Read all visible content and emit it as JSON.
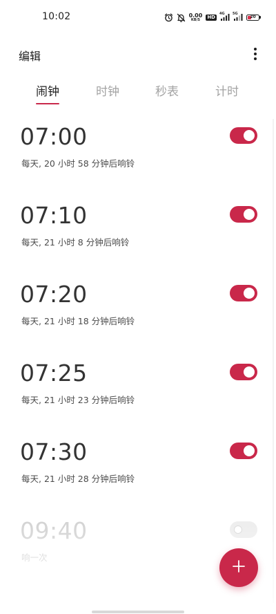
{
  "status_bar": {
    "time": "10:02",
    "net_speed_value": "0.00",
    "net_speed_unit": "KB/S",
    "hd_label": "HD",
    "signal1_tag": "4G",
    "signal2_tag": "5G",
    "battery_level": "20",
    "icons": [
      "alarm-icon",
      "mute-icon",
      "hd-icon",
      "signal-icon",
      "signal-icon",
      "battery-icon"
    ]
  },
  "header": {
    "edit_label": "编辑",
    "more_icon": "more-vertical-icon"
  },
  "tabs": [
    {
      "label": "闹钟",
      "active": true
    },
    {
      "label": "时钟",
      "active": false
    },
    {
      "label": "秒表",
      "active": false
    },
    {
      "label": "计时",
      "active": false
    }
  ],
  "alarms": [
    {
      "time": "07:00",
      "subtitle": "每天, 20 小时 58 分钟后响铃",
      "enabled": true
    },
    {
      "time": "07:10",
      "subtitle": "每天, 21 小时 8 分钟后响铃",
      "enabled": true
    },
    {
      "time": "07:20",
      "subtitle": "每天, 21 小时 18 分钟后响铃",
      "enabled": true
    },
    {
      "time": "07:25",
      "subtitle": "每天, 21 小时 23 分钟后响铃",
      "enabled": true
    },
    {
      "time": "07:30",
      "subtitle": "每天, 21 小时 28 分钟后响铃",
      "enabled": true
    },
    {
      "time": "09:40",
      "subtitle": "响一次",
      "enabled": false
    }
  ],
  "fab": {
    "icon": "plus-icon"
  },
  "colors": {
    "accent": "#c9284a",
    "toggle_off": "#ececec",
    "text_primary": "#333333",
    "text_secondary": "#4a4a4a",
    "tab_inactive": "#a3a3a3"
  }
}
